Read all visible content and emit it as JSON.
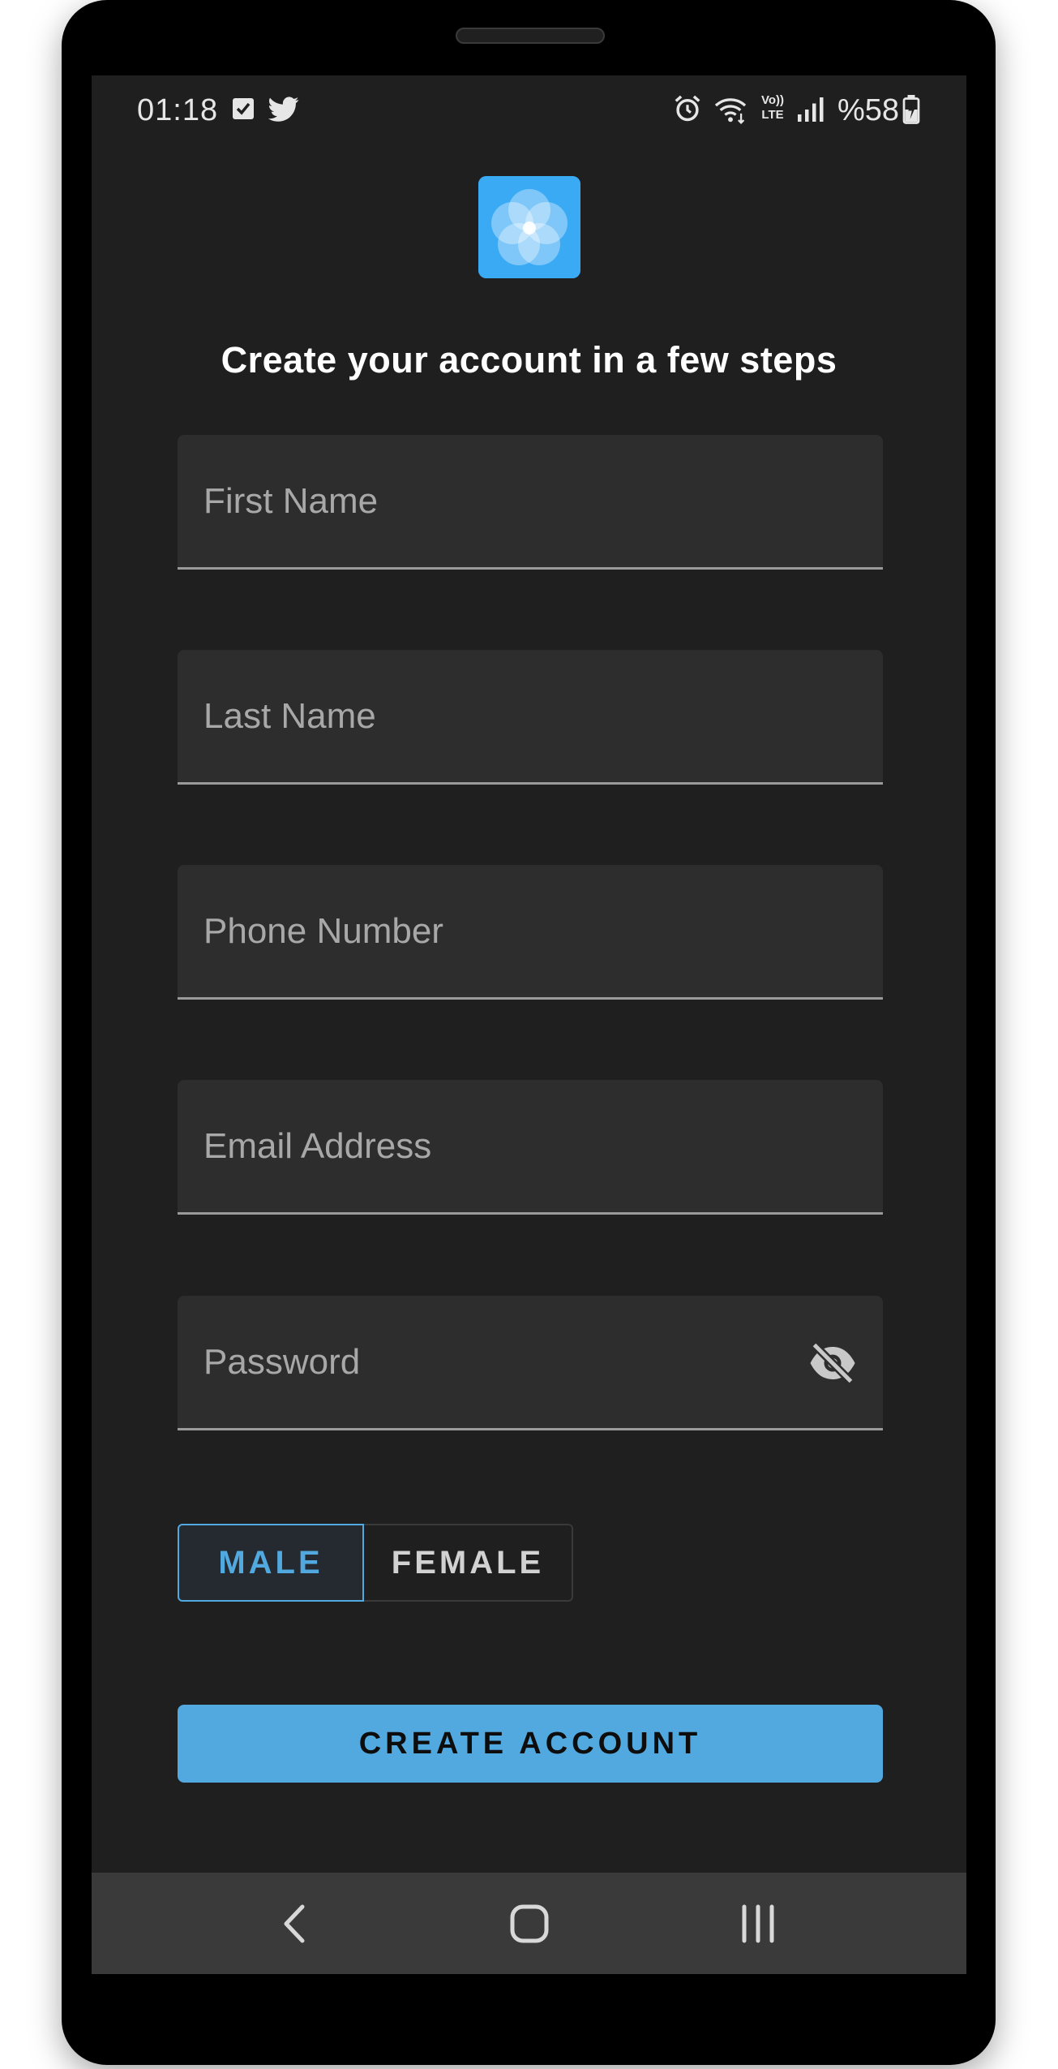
{
  "status_bar": {
    "time": "01:18",
    "battery": "%58",
    "icons": [
      "checkbox-notification-icon",
      "twitter-icon",
      "alarm-icon",
      "wifi-icon",
      "volte-icon",
      "signal-icon",
      "battery-charging-icon"
    ],
    "volte_top": "Vo))",
    "volte_bottom": "LTE"
  },
  "logo": {
    "icon": "flower-logo-icon",
    "color": "#3aaaf5"
  },
  "title": "Create your account in a few steps",
  "form": {
    "first_name": {
      "placeholder": "First Name",
      "value": ""
    },
    "last_name": {
      "placeholder": "Last Name",
      "value": ""
    },
    "phone": {
      "placeholder": "Phone Number",
      "value": ""
    },
    "email": {
      "placeholder": "Email Address",
      "value": ""
    },
    "password": {
      "placeholder": "Password",
      "value": "",
      "visibility_icon": "eye-off-icon"
    }
  },
  "gender": {
    "options": [
      "MALE",
      "FEMALE"
    ],
    "selected": "MALE"
  },
  "create_button": "CREATE ACCOUNT",
  "colors": {
    "accent": "#52a9e0",
    "background": "#1f1f1f",
    "field_background": "#2d2d2d"
  },
  "nav_bar": {
    "icons": [
      "back-icon",
      "home-icon",
      "recents-icon"
    ]
  }
}
